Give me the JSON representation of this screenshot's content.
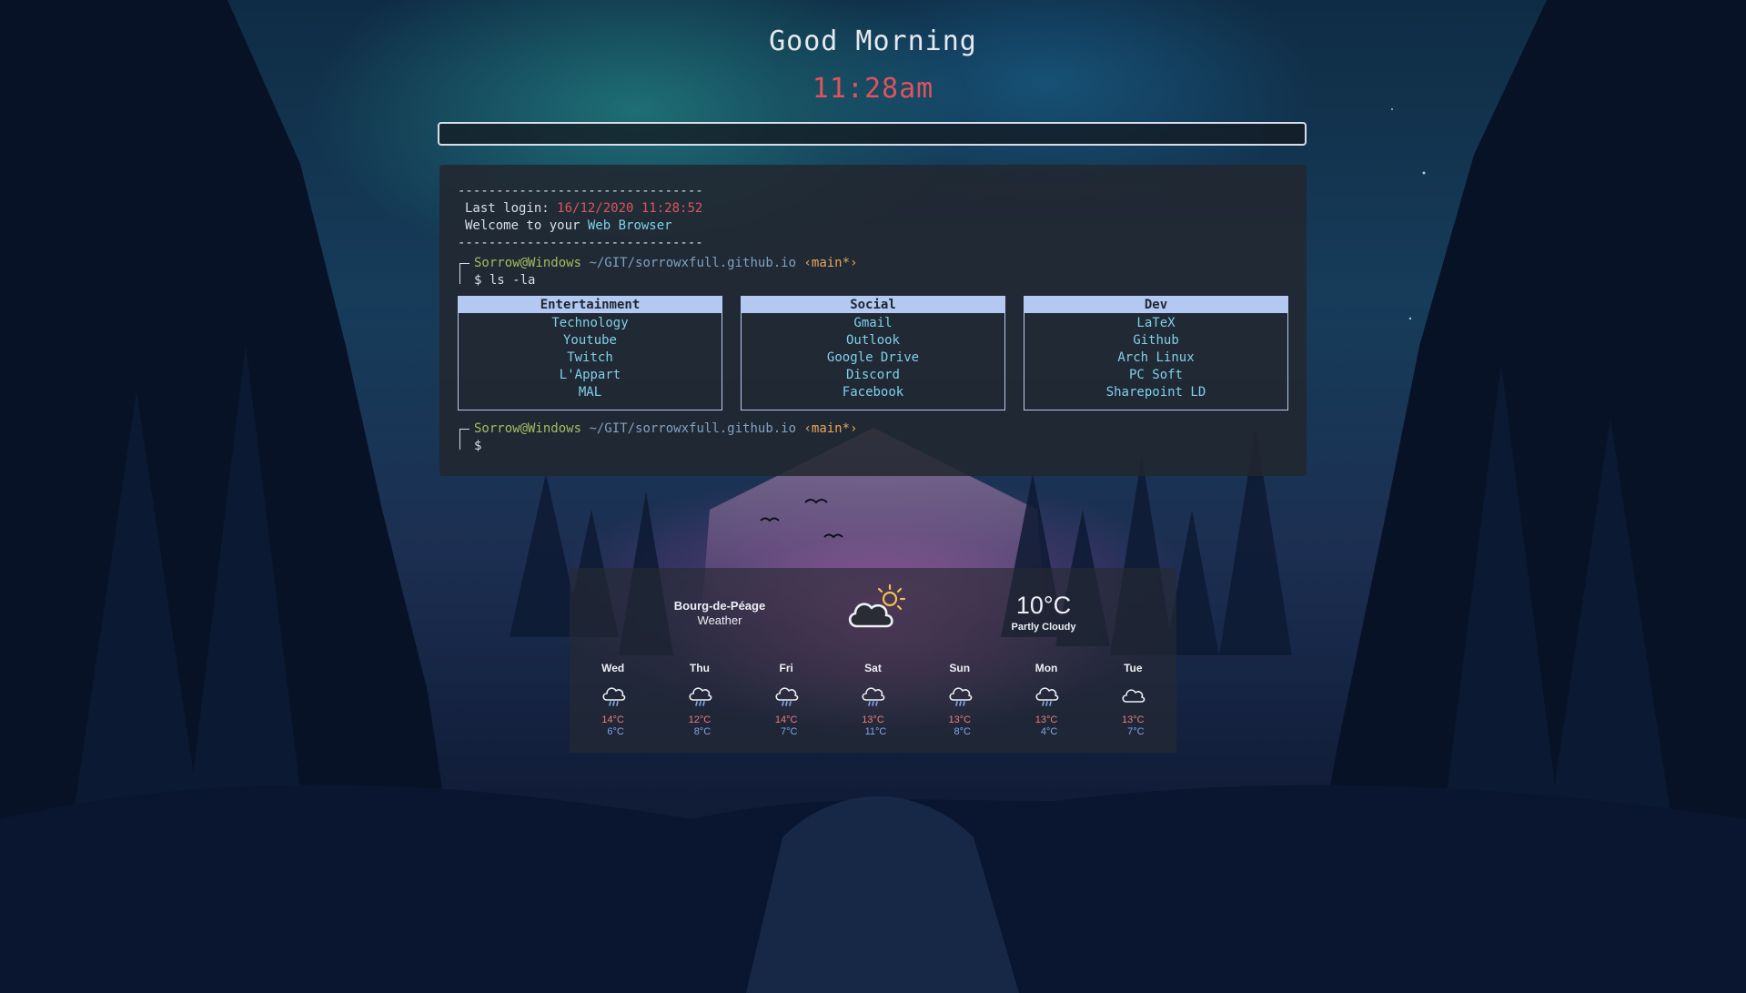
{
  "greeting": "Good Morning",
  "clock": "11:28am",
  "search": {
    "placeholder": ""
  },
  "terminal": {
    "divider": "--------------------------------",
    "last_login_label": "Last login:",
    "last_login_value": "16/12/2020 11:28:52",
    "welcome_prefix": "Welcome to your",
    "welcome_highlight": "Web Browser",
    "prompt_user": "Sorrow@Windows",
    "prompt_path": "~/GIT/sorrowxfull.github.io",
    "prompt_branch": "‹main*›",
    "command": "$ ls -la",
    "prompt2_symbol": "$",
    "columns": [
      {
        "title": "Entertainment",
        "links": [
          "Technology",
          "Youtube",
          "Twitch",
          "L'Appart",
          "MAL"
        ]
      },
      {
        "title": "Social",
        "links": [
          "Gmail",
          "Outlook",
          "Google Drive",
          "Discord",
          "Facebook"
        ]
      },
      {
        "title": "Dev",
        "links": [
          "LaTeX",
          "Github",
          "Arch Linux",
          "PC Soft",
          "Sharepoint LD"
        ]
      }
    ]
  },
  "weather": {
    "city": "Bourg-de-Péage",
    "label": "Weather",
    "current_temp": "10°C",
    "current_desc": "Partly Cloudy",
    "current_icon": "partly-cloudy-icon",
    "forecast": [
      {
        "day": "Wed",
        "icon": "rain-cloud-icon",
        "high": "14°C",
        "low": "6°C"
      },
      {
        "day": "Thu",
        "icon": "rain-cloud-icon",
        "high": "12°C",
        "low": "8°C"
      },
      {
        "day": "Fri",
        "icon": "rain-cloud-icon",
        "high": "14°C",
        "low": "7°C"
      },
      {
        "day": "Sat",
        "icon": "rain-cloud-icon",
        "high": "13°C",
        "low": "11°C"
      },
      {
        "day": "Sun",
        "icon": "rain-cloud-icon",
        "high": "13°C",
        "low": "8°C"
      },
      {
        "day": "Mon",
        "icon": "rain-cloud-icon",
        "high": "13°C",
        "low": "4°C"
      },
      {
        "day": "Tue",
        "icon": "cloud-icon",
        "high": "13°C",
        "low": "7°C"
      }
    ]
  },
  "colors": {
    "clock": "#e0535d",
    "link": "#7fd1e8",
    "user": "#a3be5c",
    "path": "#81a1c1",
    "branch": "#e9a65c",
    "column_header": "#b3c9f2"
  }
}
